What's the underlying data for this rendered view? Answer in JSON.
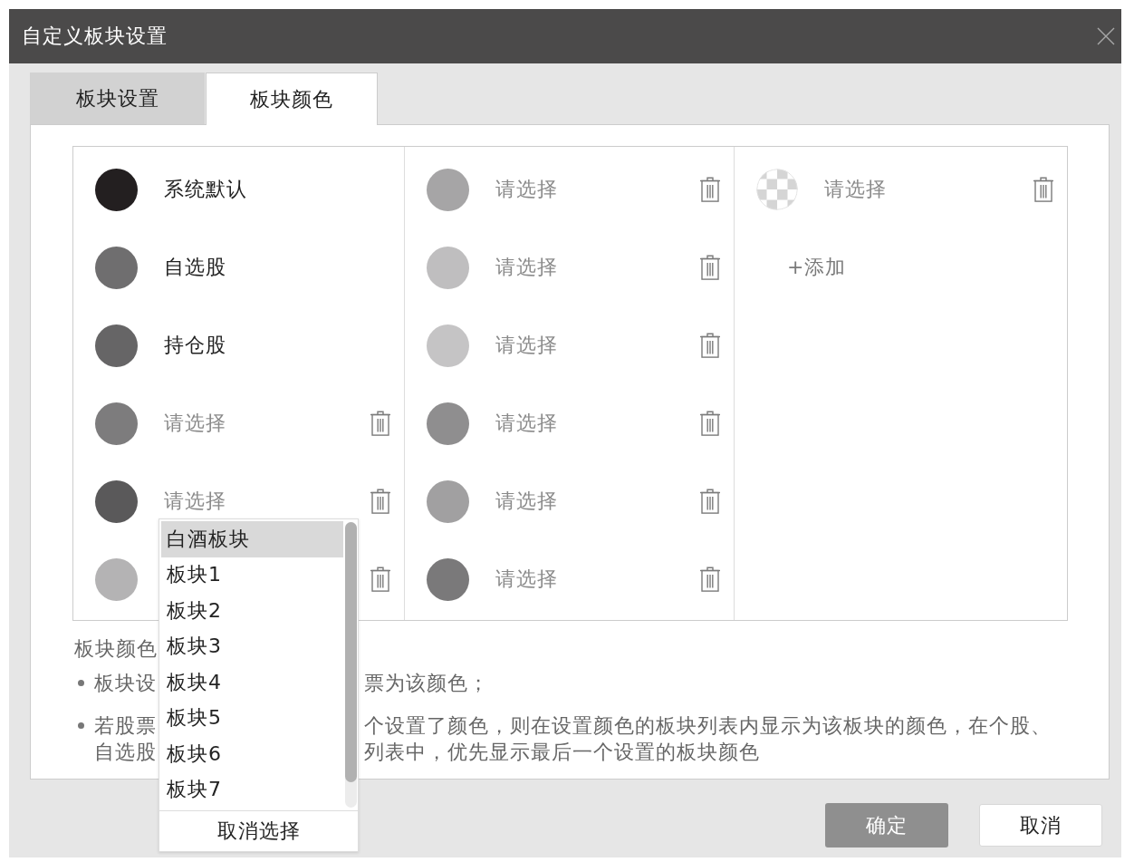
{
  "window": {
    "title": "自定义板块设置"
  },
  "tabs": [
    {
      "label": "板块设置",
      "selected": false
    },
    {
      "label": "板块颜色",
      "selected": true
    }
  ],
  "color_grid": {
    "columns": [
      {
        "items": [
          {
            "kind": "preset",
            "color": "#231f20",
            "label": "系统默认"
          },
          {
            "kind": "preset",
            "color": "#6f6e6f",
            "label": "自选股"
          },
          {
            "kind": "preset",
            "color": "#666566",
            "label": "持仓股"
          },
          {
            "kind": "custom",
            "color": "#7d7c7d",
            "label": "请选择"
          },
          {
            "kind": "custom",
            "color": "#5a595a",
            "label": "请选择"
          },
          {
            "kind": "custom",
            "color": "#b4b3b4"
          }
        ]
      },
      {
        "items": [
          {
            "kind": "custom",
            "color": "#a6a5a6",
            "label": "请选择"
          },
          {
            "kind": "custom",
            "color": "#bfbebf",
            "label": "请选择"
          },
          {
            "kind": "custom",
            "color": "#c5c4c5",
            "label": "请选择"
          },
          {
            "kind": "custom",
            "color": "#8f8e8f",
            "label": "请选择"
          },
          {
            "kind": "custom",
            "color": "#a1a0a1",
            "label": "请选择"
          },
          {
            "kind": "custom",
            "color": "#7a797a",
            "label": "请选择"
          }
        ]
      },
      {
        "items": [
          {
            "kind": "blank",
            "label": "请选择"
          },
          {
            "kind": "add",
            "label": "+添加"
          }
        ]
      }
    ]
  },
  "dropdown": {
    "options": [
      {
        "label": "白酒板块",
        "selected": true
      },
      {
        "label": "板块1",
        "selected": false
      },
      {
        "label": "板块2",
        "selected": false
      },
      {
        "label": "板块3",
        "selected": false
      },
      {
        "label": "板块4",
        "selected": false
      },
      {
        "label": "板块5",
        "selected": false
      },
      {
        "label": "板块6",
        "selected": false
      },
      {
        "label": "板块7",
        "selected": false
      }
    ],
    "footer": "取消选择"
  },
  "notes": {
    "title": "板块颜色",
    "bullets": [
      {
        "lines": [
          {
            "left": "板块设",
            "right": "票为该颜色；"
          }
        ]
      },
      {
        "lines": [
          {
            "left": "若股票",
            "right": "个设置了颜色，则在设置颜色的板块列表内显示为该板块的颜色，在个股、"
          },
          {
            "left": "自选股",
            "right": "列表中，优先显示最后一个设置的板块颜色"
          }
        ]
      }
    ]
  },
  "buttons": [
    {
      "label": "确定",
      "kind": "primary"
    },
    {
      "label": "取消",
      "kind": "default"
    }
  ]
}
